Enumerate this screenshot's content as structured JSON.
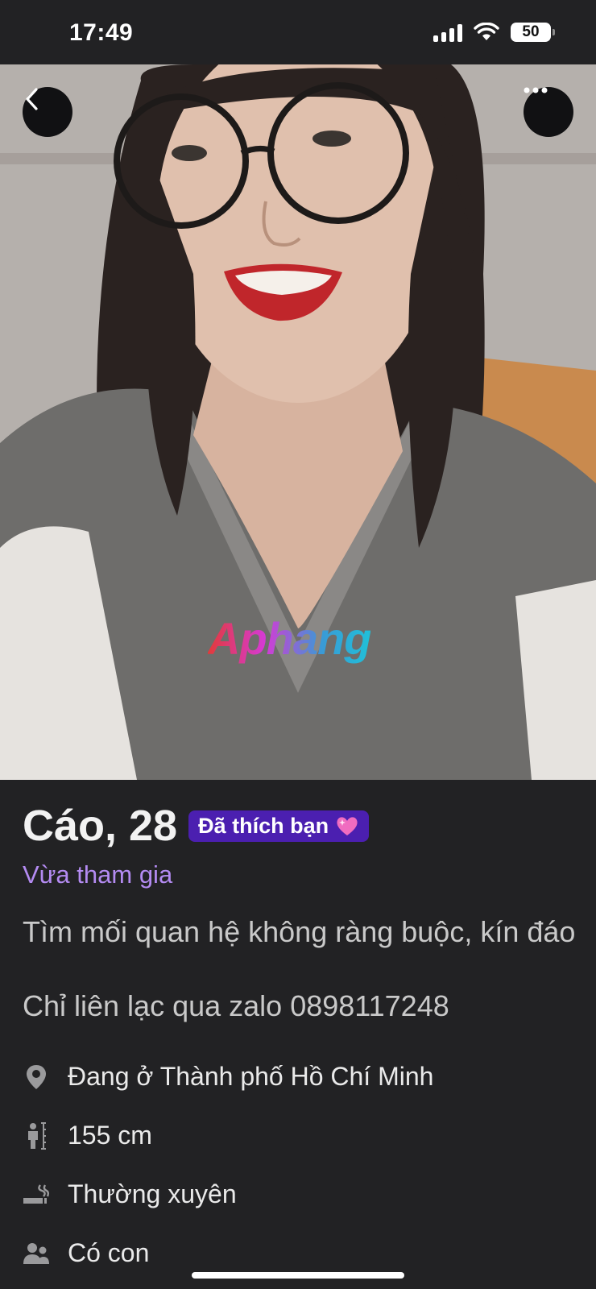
{
  "status_bar": {
    "time": "17:49",
    "battery": "50"
  },
  "profile": {
    "name_age": "Cáo, 28",
    "liked_badge": "Đã thích bạn",
    "joined_label": "Vừa tham gia",
    "bio": "Tìm mối quan hệ không ràng buộc, kín đáo",
    "contact": "Chỉ liên lạc qua zalo 0898117248",
    "watermark": "Aphang",
    "details": [
      {
        "icon": "location-pin-icon",
        "text": "Đang ở Thành phố Hồ Chí Minh"
      },
      {
        "icon": "height-icon",
        "text": "155 cm"
      },
      {
        "icon": "smoking-icon",
        "text": "Thường xuyên"
      },
      {
        "icon": "children-icon",
        "text": "Có con"
      }
    ]
  },
  "colors": {
    "background": "#222224",
    "badge": "#4b1fb0",
    "joined_accent": "#b48bf2"
  }
}
